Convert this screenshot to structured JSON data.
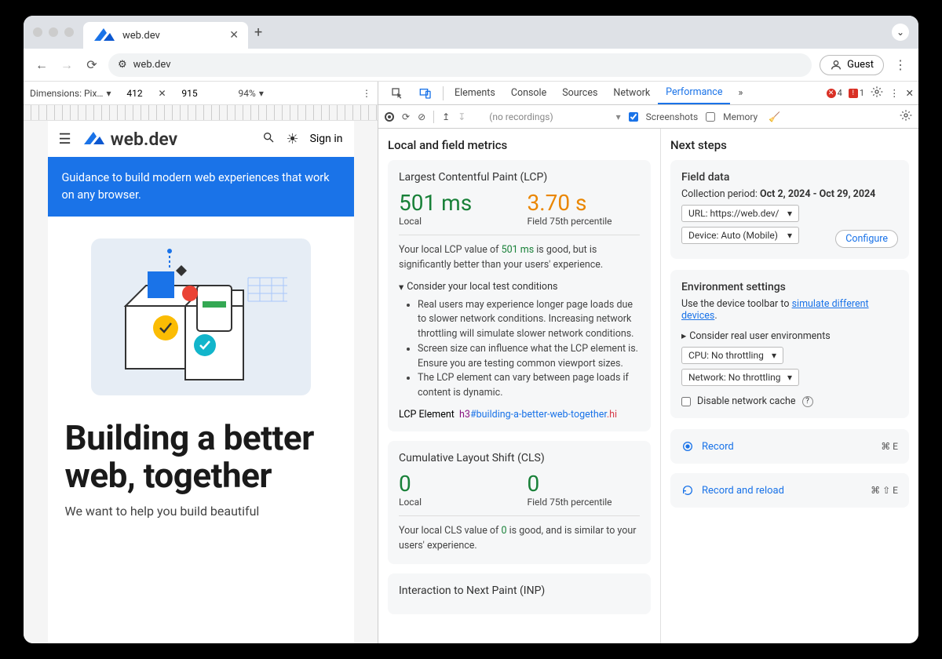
{
  "browser": {
    "tab_title": "web.dev",
    "url_display": "web.dev",
    "guest_label": "Guest"
  },
  "device_toolbar": {
    "dimensions_label": "Dimensions: Pix…",
    "width": "412",
    "height": "915",
    "zoom": "94%"
  },
  "site": {
    "menu_icon": "menu",
    "brand": "web.dev",
    "signin": "Sign in",
    "banner": "Guidance to build modern web experiences that work on any browser.",
    "hero": "Building a better web, together",
    "subtitle": "We want to help you build beautiful"
  },
  "devtools": {
    "tabs": [
      "Elements",
      "Console",
      "Sources",
      "Network",
      "Performance"
    ],
    "active_tab": "Performance",
    "errors": "4",
    "issues": "1",
    "perf_bar": {
      "recordings_placeholder": "(no recordings)",
      "cb_screenshots": "Screenshots",
      "cb_memory": "Memory"
    }
  },
  "metrics": {
    "title": "Local and field metrics",
    "lcp": {
      "heading": "Largest Contentful Paint (LCP)",
      "local_value": "501 ms",
      "local_label": "Local",
      "field_value": "3.70 s",
      "field_label": "Field 75th percentile",
      "summary_prefix": "Your local LCP value of ",
      "summary_value": "501 ms",
      "summary_suffix": " is good, but is significantly better than your users' experience.",
      "consider_label": "Consider your local test conditions",
      "bullets": [
        "Real users may experience longer page loads due to slower network conditions. Increasing network throttling will simulate slower network conditions.",
        "Screen size can influence what the LCP element is. Ensure you are testing common viewport sizes.",
        "The LCP element can vary between page loads if content is dynamic."
      ],
      "lcp_element_label": "LCP Element",
      "lcp_tag": "h3",
      "lcp_id": "#building-a-better-web-together",
      "lcp_cls": ".hi"
    },
    "cls": {
      "heading": "Cumulative Layout Shift (CLS)",
      "local_value": "0",
      "local_label": "Local",
      "field_value": "0",
      "field_label": "Field 75th percentile",
      "summary_prefix": "Your local CLS value of ",
      "summary_value": "0",
      "summary_suffix": " is good, and is similar to your users' experience."
    },
    "inp": {
      "heading": "Interaction to Next Paint (INP)"
    }
  },
  "next": {
    "title": "Next steps",
    "field": {
      "heading": "Field data",
      "collection_label": "Collection period:",
      "collection_period": "Oct 2, 2024 - Oct 29, 2024",
      "url_select": "URL: https://web.dev/",
      "device_select": "Device: Auto (Mobile)",
      "configure": "Configure"
    },
    "env": {
      "heading": "Environment settings",
      "hint_prefix": "Use the device toolbar to ",
      "hint_link": "simulate different devices",
      "consider": "Consider real user environments",
      "cpu_select": "CPU: No throttling",
      "net_select": "Network: No throttling",
      "disable_cache": "Disable network cache"
    },
    "record": {
      "label": "Record",
      "kbd": "⌘ E"
    },
    "record_reload": {
      "label": "Record and reload",
      "kbd": "⌘ ⇧ E"
    }
  }
}
